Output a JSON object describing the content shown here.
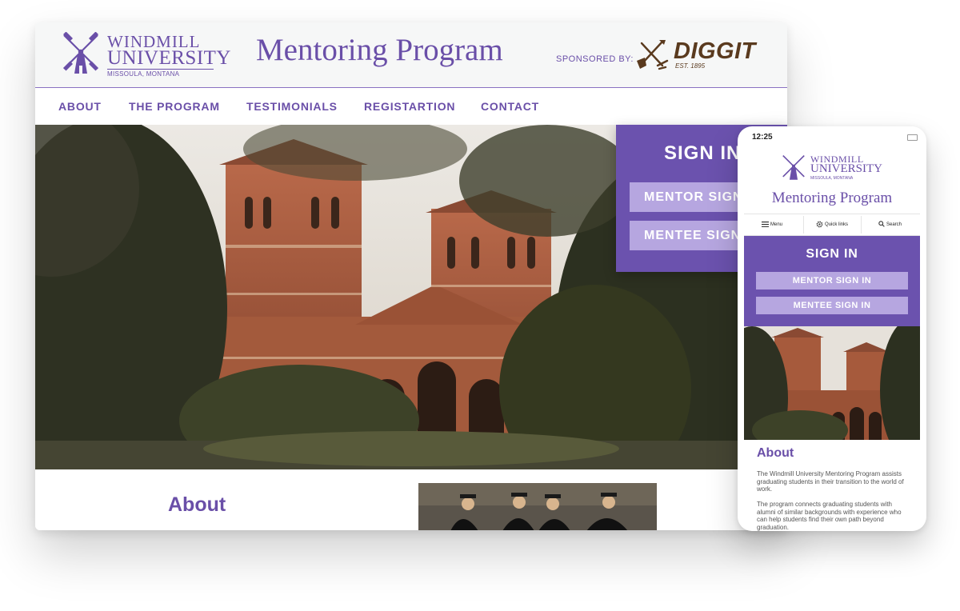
{
  "desktop": {
    "logo": {
      "line1": "WINDMILL",
      "line2": "UNIVERSITY",
      "line3": "MISSOULA, MONTANA"
    },
    "site_title": "Mentoring Program",
    "sponsor": {
      "label": "SPONSORED BY:",
      "name": "DIGGIT",
      "tagline": "EST. 1895"
    },
    "nav": [
      "ABOUT",
      "THE PROGRAM",
      "TESTIMONIALS",
      "REGISTARTION",
      "CONTACT"
    ],
    "signin": {
      "title": "SIGN IN",
      "mentor": "MENTOR SIGN IN",
      "mentee": "MENTEE SIGN IN"
    },
    "about_heading": "About"
  },
  "mobile": {
    "status_time": "12:25",
    "logo": {
      "line1": "WINDMILL",
      "line2": "UNIVERSITY",
      "line3": "MISSOULA, MONTANA"
    },
    "site_title": "Mentoring Program",
    "nav": {
      "menu": "Menu",
      "quick_links": "Quick links",
      "search": "Search"
    },
    "signin": {
      "title": "SIGN IN",
      "mentor": "MENTOR SIGN IN",
      "mentee": "MENTEE SIGN IN"
    },
    "about_heading": "About",
    "about_p1": "The Windmill University Mentoring Program assists graduating students in their transition to the world of work.",
    "about_p2": "The program connects graduating students with alumni of similar backgrounds with experience who can help students find their own path beyond graduation."
  },
  "colors": {
    "brand_purple": "#6a4fa8",
    "signin_bg": "#6b52ae",
    "button_lavender": "#b6a6e0",
    "sponsor_brown": "#5a3a1e"
  }
}
